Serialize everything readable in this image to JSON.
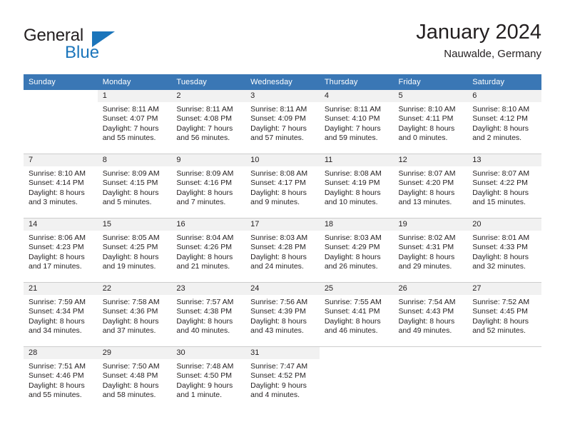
{
  "brand": {
    "word_one": "General",
    "word_two": "Blue",
    "accent_color": "#1b75bb"
  },
  "header": {
    "title": "January 2024",
    "subtitle": "Nauwalde, Germany"
  },
  "theme": {
    "header_row_bg": "#3a77b5",
    "daynum_band_bg": "#f1f1f1",
    "grid_line": "#cdcdcd",
    "text": "#231f20"
  },
  "weekdays": [
    "Sunday",
    "Monday",
    "Tuesday",
    "Wednesday",
    "Thursday",
    "Friday",
    "Saturday"
  ],
  "labels": {
    "sunrise_prefix": "Sunrise:",
    "sunset_prefix": "Sunset:",
    "daylight_prefix": "Daylight:"
  },
  "weeks": [
    [
      {
        "day": "",
        "blank": true
      },
      {
        "day": "1",
        "sunrise": "Sunrise: 8:11 AM",
        "sunset": "Sunset: 4:07 PM",
        "daylight_line1": "Daylight: 7 hours",
        "daylight_line2": "and 55 minutes."
      },
      {
        "day": "2",
        "sunrise": "Sunrise: 8:11 AM",
        "sunset": "Sunset: 4:08 PM",
        "daylight_line1": "Daylight: 7 hours",
        "daylight_line2": "and 56 minutes."
      },
      {
        "day": "3",
        "sunrise": "Sunrise: 8:11 AM",
        "sunset": "Sunset: 4:09 PM",
        "daylight_line1": "Daylight: 7 hours",
        "daylight_line2": "and 57 minutes."
      },
      {
        "day": "4",
        "sunrise": "Sunrise: 8:11 AM",
        "sunset": "Sunset: 4:10 PM",
        "daylight_line1": "Daylight: 7 hours",
        "daylight_line2": "and 59 minutes."
      },
      {
        "day": "5",
        "sunrise": "Sunrise: 8:10 AM",
        "sunset": "Sunset: 4:11 PM",
        "daylight_line1": "Daylight: 8 hours",
        "daylight_line2": "and 0 minutes."
      },
      {
        "day": "6",
        "sunrise": "Sunrise: 8:10 AM",
        "sunset": "Sunset: 4:12 PM",
        "daylight_line1": "Daylight: 8 hours",
        "daylight_line2": "and 2 minutes."
      }
    ],
    [
      {
        "day": "7",
        "sunrise": "Sunrise: 8:10 AM",
        "sunset": "Sunset: 4:14 PM",
        "daylight_line1": "Daylight: 8 hours",
        "daylight_line2": "and 3 minutes."
      },
      {
        "day": "8",
        "sunrise": "Sunrise: 8:09 AM",
        "sunset": "Sunset: 4:15 PM",
        "daylight_line1": "Daylight: 8 hours",
        "daylight_line2": "and 5 minutes."
      },
      {
        "day": "9",
        "sunrise": "Sunrise: 8:09 AM",
        "sunset": "Sunset: 4:16 PM",
        "daylight_line1": "Daylight: 8 hours",
        "daylight_line2": "and 7 minutes."
      },
      {
        "day": "10",
        "sunrise": "Sunrise: 8:08 AM",
        "sunset": "Sunset: 4:17 PM",
        "daylight_line1": "Daylight: 8 hours",
        "daylight_line2": "and 9 minutes."
      },
      {
        "day": "11",
        "sunrise": "Sunrise: 8:08 AM",
        "sunset": "Sunset: 4:19 PM",
        "daylight_line1": "Daylight: 8 hours",
        "daylight_line2": "and 10 minutes."
      },
      {
        "day": "12",
        "sunrise": "Sunrise: 8:07 AM",
        "sunset": "Sunset: 4:20 PM",
        "daylight_line1": "Daylight: 8 hours",
        "daylight_line2": "and 13 minutes."
      },
      {
        "day": "13",
        "sunrise": "Sunrise: 8:07 AM",
        "sunset": "Sunset: 4:22 PM",
        "daylight_line1": "Daylight: 8 hours",
        "daylight_line2": "and 15 minutes."
      }
    ],
    [
      {
        "day": "14",
        "sunrise": "Sunrise: 8:06 AM",
        "sunset": "Sunset: 4:23 PM",
        "daylight_line1": "Daylight: 8 hours",
        "daylight_line2": "and 17 minutes."
      },
      {
        "day": "15",
        "sunrise": "Sunrise: 8:05 AM",
        "sunset": "Sunset: 4:25 PM",
        "daylight_line1": "Daylight: 8 hours",
        "daylight_line2": "and 19 minutes."
      },
      {
        "day": "16",
        "sunrise": "Sunrise: 8:04 AM",
        "sunset": "Sunset: 4:26 PM",
        "daylight_line1": "Daylight: 8 hours",
        "daylight_line2": "and 21 minutes."
      },
      {
        "day": "17",
        "sunrise": "Sunrise: 8:03 AM",
        "sunset": "Sunset: 4:28 PM",
        "daylight_line1": "Daylight: 8 hours",
        "daylight_line2": "and 24 minutes."
      },
      {
        "day": "18",
        "sunrise": "Sunrise: 8:03 AM",
        "sunset": "Sunset: 4:29 PM",
        "daylight_line1": "Daylight: 8 hours",
        "daylight_line2": "and 26 minutes."
      },
      {
        "day": "19",
        "sunrise": "Sunrise: 8:02 AM",
        "sunset": "Sunset: 4:31 PM",
        "daylight_line1": "Daylight: 8 hours",
        "daylight_line2": "and 29 minutes."
      },
      {
        "day": "20",
        "sunrise": "Sunrise: 8:01 AM",
        "sunset": "Sunset: 4:33 PM",
        "daylight_line1": "Daylight: 8 hours",
        "daylight_line2": "and 32 minutes."
      }
    ],
    [
      {
        "day": "21",
        "sunrise": "Sunrise: 7:59 AM",
        "sunset": "Sunset: 4:34 PM",
        "daylight_line1": "Daylight: 8 hours",
        "daylight_line2": "and 34 minutes."
      },
      {
        "day": "22",
        "sunrise": "Sunrise: 7:58 AM",
        "sunset": "Sunset: 4:36 PM",
        "daylight_line1": "Daylight: 8 hours",
        "daylight_line2": "and 37 minutes."
      },
      {
        "day": "23",
        "sunrise": "Sunrise: 7:57 AM",
        "sunset": "Sunset: 4:38 PM",
        "daylight_line1": "Daylight: 8 hours",
        "daylight_line2": "and 40 minutes."
      },
      {
        "day": "24",
        "sunrise": "Sunrise: 7:56 AM",
        "sunset": "Sunset: 4:39 PM",
        "daylight_line1": "Daylight: 8 hours",
        "daylight_line2": "and 43 minutes."
      },
      {
        "day": "25",
        "sunrise": "Sunrise: 7:55 AM",
        "sunset": "Sunset: 4:41 PM",
        "daylight_line1": "Daylight: 8 hours",
        "daylight_line2": "and 46 minutes."
      },
      {
        "day": "26",
        "sunrise": "Sunrise: 7:54 AM",
        "sunset": "Sunset: 4:43 PM",
        "daylight_line1": "Daylight: 8 hours",
        "daylight_line2": "and 49 minutes."
      },
      {
        "day": "27",
        "sunrise": "Sunrise: 7:52 AM",
        "sunset": "Sunset: 4:45 PM",
        "daylight_line1": "Daylight: 8 hours",
        "daylight_line2": "and 52 minutes."
      }
    ],
    [
      {
        "day": "28",
        "sunrise": "Sunrise: 7:51 AM",
        "sunset": "Sunset: 4:46 PM",
        "daylight_line1": "Daylight: 8 hours",
        "daylight_line2": "and 55 minutes."
      },
      {
        "day": "29",
        "sunrise": "Sunrise: 7:50 AM",
        "sunset": "Sunset: 4:48 PM",
        "daylight_line1": "Daylight: 8 hours",
        "daylight_line2": "and 58 minutes."
      },
      {
        "day": "30",
        "sunrise": "Sunrise: 7:48 AM",
        "sunset": "Sunset: 4:50 PM",
        "daylight_line1": "Daylight: 9 hours",
        "daylight_line2": "and 1 minute."
      },
      {
        "day": "31",
        "sunrise": "Sunrise: 7:47 AM",
        "sunset": "Sunset: 4:52 PM",
        "daylight_line1": "Daylight: 9 hours",
        "daylight_line2": "and 4 minutes."
      },
      {
        "day": "",
        "blank": true
      },
      {
        "day": "",
        "blank": true
      },
      {
        "day": "",
        "blank": true
      }
    ]
  ]
}
